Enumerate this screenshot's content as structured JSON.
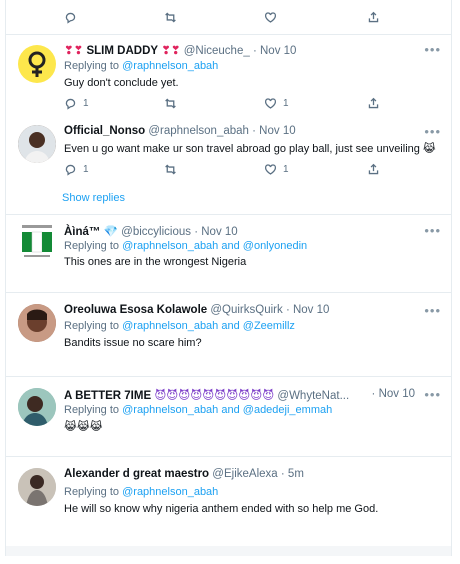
{
  "top_actions": {
    "reply_count": "",
    "retweet_count": "",
    "like_count": ""
  },
  "tweets": [
    {
      "name_prefix": "❣❣",
      "name": "SLIM DADDY",
      "name_suffix": "❣❣",
      "handle": "@Niceuche_",
      "date": "Nov 10",
      "replying_prefix": "Replying to",
      "replying_to": "@raphnelson_abah",
      "replying_and": "",
      "replying_to2": "",
      "text": "Guy don't conclude yet.",
      "reply_count": "1",
      "retweet_count": "",
      "like_count": "1"
    },
    {
      "name": "Official_Nonso",
      "handle": "@raphnelson_abah",
      "date": "Nov 10",
      "text": "Even u go want make ur son travel abroad go play ball, just see unveiling 😹",
      "reply_count": "1",
      "retweet_count": "",
      "like_count": "1",
      "show_replies": "Show replies"
    },
    {
      "name": "Àìná™",
      "name_suffix": "💎",
      "handle": "@biccylicious",
      "date": "Nov 10",
      "replying_prefix": "Replying to",
      "replying_to": "@raphnelson_abah",
      "replying_and": "and",
      "replying_to2": "@onlyonedin",
      "text": "This ones are in the wrongest Nigeria"
    },
    {
      "name": "Oreoluwa Esosa Kolawole",
      "handle": "@QuirksQuirk",
      "date": "Nov 10",
      "replying_prefix": "Replying to",
      "replying_to": "@raphnelson_abah",
      "replying_and": "and",
      "replying_to2": "@Zeemillz",
      "text": "Bandits issue no scare him?"
    },
    {
      "name": "A BETTER 7IME",
      "name_suffix": "😈😈😈😈😈😈😈😈😈😈",
      "handle": "@WhyteNat...",
      "date": "Nov 10",
      "replying_prefix": "Replying to",
      "replying_to": "@raphnelson_abah",
      "replying_and": "and",
      "replying_to2": "@adedeji_emmah",
      "text": "😹😹😹"
    },
    {
      "name": "Alexander d great maestro",
      "handle": "@EjikeAlexa",
      "date": "5m",
      "replying_prefix": "Replying to",
      "replying_to": "@raphnelson_abah",
      "replying_and": "",
      "replying_to2": "",
      "text": "He will so know why nigeria anthem ended with so help me God."
    }
  ],
  "separator": "·",
  "colors": {
    "link": "#1da1f2",
    "muted": "#5b7083",
    "border": "#e6ecf0"
  }
}
